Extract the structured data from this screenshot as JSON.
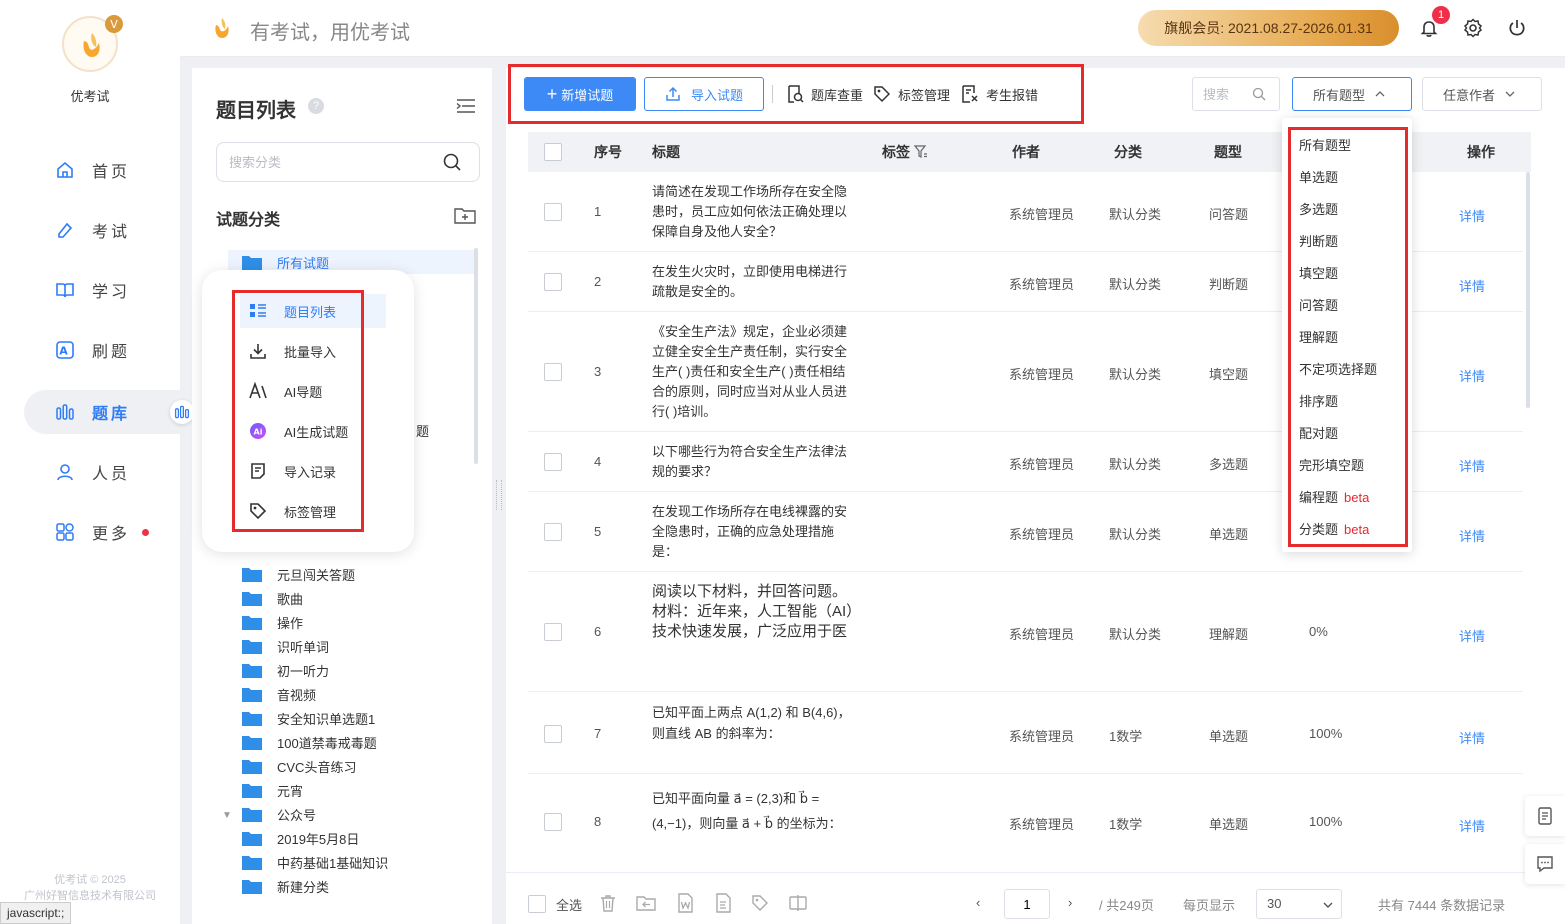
{
  "app": {
    "name": "优考试",
    "slogan": "有考试，用优考试",
    "copyright_line1": "优考试 © 2025",
    "copyright_line2": "广州好智信息技术有限公司",
    "status_url": "javascript:;"
  },
  "header": {
    "vip_text": "旗舰会员:  2021.08.27-2026.01.31",
    "notification_count": "1"
  },
  "nav": [
    {
      "label": "首页",
      "icon": "home-icon"
    },
    {
      "label": "考试",
      "icon": "exam-icon"
    },
    {
      "label": "学习",
      "icon": "book-icon"
    },
    {
      "label": "刷题",
      "icon": "practice-icon"
    },
    {
      "label": "题库",
      "icon": "question-bank-icon",
      "active": true
    },
    {
      "label": "人员",
      "icon": "user-icon"
    },
    {
      "label": "更多",
      "icon": "more-icon"
    }
  ],
  "category_panel": {
    "title": "题目列表",
    "search_placeholder": "搜索分类",
    "section_title": "试题分类",
    "tree": [
      "所有试题",
      "元旦闯关答题",
      "歌曲",
      "操作",
      "识听单词",
      "初一听力",
      "音视频",
      "安全知识单选题1",
      "100道禁毒戒毒题",
      "CVC头音练习",
      "元宵",
      "公众号",
      "2019年5月8日",
      "中药基础1基础知识",
      "新建分类"
    ],
    "partial_item": "题"
  },
  "popup_menu": [
    {
      "label": "题目列表",
      "icon": "list-icon",
      "active": true
    },
    {
      "label": "批量导入",
      "icon": "download-icon"
    },
    {
      "label": "AI导题",
      "icon": "ai-import-icon"
    },
    {
      "label": "AI生成试题",
      "icon": "ai-generate-icon"
    },
    {
      "label": "导入记录",
      "icon": "record-icon"
    },
    {
      "label": "标签管理",
      "icon": "tag-icon"
    }
  ],
  "toolbar": {
    "add_label": "新增试题",
    "import_label": "导入试题",
    "dedupe_label": "题库查重",
    "tag_label": "标签管理",
    "report_label": "考生报错",
    "search_placeholder": "搜索",
    "type_filter": "所有题型",
    "author_filter": "任意作者"
  },
  "table": {
    "headers": {
      "index": "序号",
      "title": "标题",
      "tag": "标签",
      "author": "作者",
      "category": "分类",
      "type": "题型",
      "action": "操作"
    },
    "detail_label": "详情",
    "rows": [
      {
        "index": "1",
        "title": "请简述在发现工作场所存在安全隐患时，员工应如何依法正确处理以保障自身及他人安全？",
        "author": "系统管理员",
        "category": "默认分类",
        "type": "问答题",
        "rate": ""
      },
      {
        "index": "2",
        "title": "在发生火灾时，立即使用电梯进行疏散是安全的。",
        "author": "系统管理员",
        "category": "默认分类",
        "type": "判断题",
        "rate": ""
      },
      {
        "index": "3",
        "title": "《安全生产法》规定，企业必须建立健全安全生产责任制，实行安全生产(   )责任和安全生产(   )责任相结合的原则，同时应当对从业人员进行(   )培训。",
        "author": "系统管理员",
        "category": "默认分类",
        "type": "填空题",
        "rate": ""
      },
      {
        "index": "4",
        "title": "以下哪些行为符合安全生产法律法规的要求？",
        "author": "系统管理员",
        "category": "默认分类",
        "type": "多选题",
        "rate": ""
      },
      {
        "index": "5",
        "title": "在发现工作场所存在电线裸露的安全隐患时，正确的应急处理措施是：",
        "author": "系统管理员",
        "category": "默认分类",
        "type": "单选题",
        "rate": ""
      },
      {
        "index": "6",
        "title": "阅读以下材料，并回答问题。材料：近年来，人工智能（AI）技术快速发展，广泛应用于医",
        "author": "系统管理员",
        "category": "默认分类",
        "type": "理解题",
        "rate": "0%"
      },
      {
        "index": "7",
        "title": "已知平面上两点 A(1,2) 和 B(4,6)，则直线 AB 的斜率为：",
        "author": "系统管理员",
        "category": "1数学",
        "type": "单选题",
        "rate": "100%"
      },
      {
        "index": "8",
        "title": "已知平面向量 a⃗ = (2,3)和 b⃗ = (4,−1)，则向量 a⃗ + b⃗ 的坐标为：",
        "author": "系统管理员",
        "category": "1数学",
        "type": "单选题",
        "rate": "100%"
      }
    ]
  },
  "type_dropdown": [
    {
      "label": "所有题型"
    },
    {
      "label": "单选题"
    },
    {
      "label": "多选题"
    },
    {
      "label": "判断题"
    },
    {
      "label": "填空题"
    },
    {
      "label": "问答题"
    },
    {
      "label": "理解题"
    },
    {
      "label": "不定项选择题"
    },
    {
      "label": "排序题"
    },
    {
      "label": "配对题"
    },
    {
      "label": "完形填空题"
    },
    {
      "label": "编程题",
      "badge": "beta"
    },
    {
      "label": "分类题",
      "badge": "beta"
    }
  ],
  "footer": {
    "select_all": "全选",
    "current_page": "1",
    "total_pages": "/ 共249页",
    "per_page_label": "每页显示",
    "per_page_value": "30",
    "total_records": "共有 7444 条数据记录"
  },
  "colors": {
    "primary": "#3d8af7",
    "highlight_frame": "#e52b2b",
    "badge": "#f0304a"
  }
}
